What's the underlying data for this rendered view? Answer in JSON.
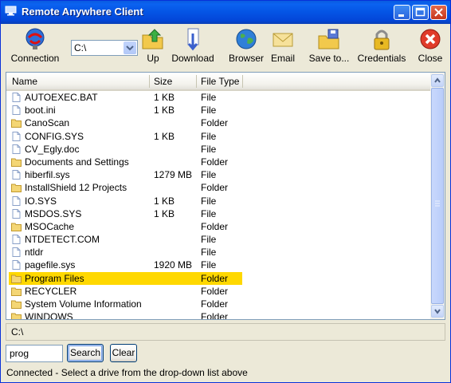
{
  "window": {
    "title": "Remote Anywhere Client"
  },
  "toolbar": {
    "connection": "Connection",
    "drive_value": "C:\\",
    "up": "Up",
    "download": "Download",
    "browser": "Browser",
    "email": "Email",
    "save_to": "Save to...",
    "credentials": "Credentials",
    "close": "Close"
  },
  "list": {
    "columns": {
      "name": "Name",
      "size": "Size",
      "type": "File Type"
    },
    "rows": [
      {
        "name": "AUTOEXEC.BAT",
        "size": "1 KB",
        "type": "File",
        "icon": "file"
      },
      {
        "name": "boot.ini",
        "size": "1 KB",
        "type": "File",
        "icon": "file"
      },
      {
        "name": "CanoScan",
        "size": "",
        "type": "Folder",
        "icon": "folder"
      },
      {
        "name": "CONFIG.SYS",
        "size": "1 KB",
        "type": "File",
        "icon": "file"
      },
      {
        "name": "CV_Egly.doc",
        "size": "",
        "type": "File",
        "icon": "file"
      },
      {
        "name": "Documents and Settings",
        "size": "",
        "type": "Folder",
        "icon": "folder"
      },
      {
        "name": "hiberfil.sys",
        "size": "1279 MB",
        "type": "File",
        "icon": "file"
      },
      {
        "name": "InstallShield 12 Projects",
        "size": "",
        "type": "Folder",
        "icon": "folder"
      },
      {
        "name": "IO.SYS",
        "size": "1 KB",
        "type": "File",
        "icon": "file"
      },
      {
        "name": "MSDOS.SYS",
        "size": "1 KB",
        "type": "File",
        "icon": "file"
      },
      {
        "name": "MSOCache",
        "size": "",
        "type": "Folder",
        "icon": "folder"
      },
      {
        "name": "NTDETECT.COM",
        "size": "",
        "type": "File",
        "icon": "file"
      },
      {
        "name": "ntldr",
        "size": "",
        "type": "File",
        "icon": "file"
      },
      {
        "name": "pagefile.sys",
        "size": "1920 MB",
        "type": "File",
        "icon": "file"
      },
      {
        "name": "Program Files",
        "size": "",
        "type": "Folder",
        "icon": "folder",
        "selected": true
      },
      {
        "name": "RECYCLER",
        "size": "",
        "type": "Folder",
        "icon": "folder"
      },
      {
        "name": "System Volume Information",
        "size": "",
        "type": "Folder",
        "icon": "folder"
      },
      {
        "name": "WINDOWS",
        "size": "",
        "type": "Folder",
        "icon": "folder"
      }
    ]
  },
  "path": "C:\\",
  "search": {
    "value": "prog",
    "button": "Search",
    "clear": "Clear"
  },
  "status": "Connected - Select a drive from the drop-down list above",
  "colors": {
    "titlebar": "#0454e4",
    "selection": "#ffd800",
    "chrome": "#ece9d8"
  }
}
